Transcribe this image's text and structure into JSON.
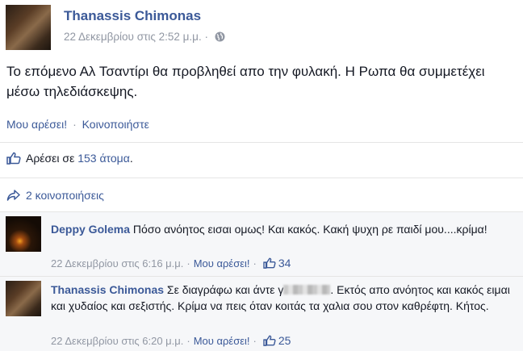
{
  "post": {
    "author": "Thanassis Chimonas",
    "timestamp": "22 Δεκεμβρίου στις 2:52 μ.μ.",
    "separator": "·",
    "text": "Το επόμενο Αλ Τσαντίρι θα προβληθεί απο την φυλακή. Η Ρωπα θα συμμετέχει μέσω τηλεδιάσκεψης.",
    "like_label": "Μου αρέσει!",
    "action_separator": "·",
    "share_label": "Κοινοποιήστε"
  },
  "likes": {
    "prefix": "Αρέσει σε ",
    "link": "153 άτομα",
    "suffix": "."
  },
  "shares": {
    "label": "2 κοινοποιήσεις"
  },
  "comments": [
    {
      "author": "Deppy Golema",
      "text": " Πόσο ανόητος εισαι ομως! Και κακός. Κακή ψυχη ρε παιδί μου....κρίμα!",
      "timestamp": "22 Δεκεμβρίου στις 6:16 μ.μ.",
      "separator": "·",
      "like_label": "Μου αρέσει!",
      "like_count": "34"
    },
    {
      "author": "Thanassis Chimonas",
      "text_before": " Σε διαγράφω και άντε γ",
      "text_after": ". Εκτός απο ανόητος και κακός ειμαι και χυδαίος και σεξιστής. Κρίμα να πεις όταν κοιτάς τα χαλια σου στον καθρέφτη. Κήτος.",
      "timestamp": "22 Δεκεμβρίου στις 6:20 μ.μ.",
      "separator": "·",
      "like_label": "Μου αρέσει!",
      "like_count": "25"
    }
  ],
  "colors": {
    "link": "#3b5998",
    "meta": "#9197a3",
    "comment_bg": "#f6f7f9"
  },
  "icons": {
    "privacy": "globe-icon",
    "likes": "thumbs-up-icon",
    "shares": "share-arrow-icon"
  }
}
